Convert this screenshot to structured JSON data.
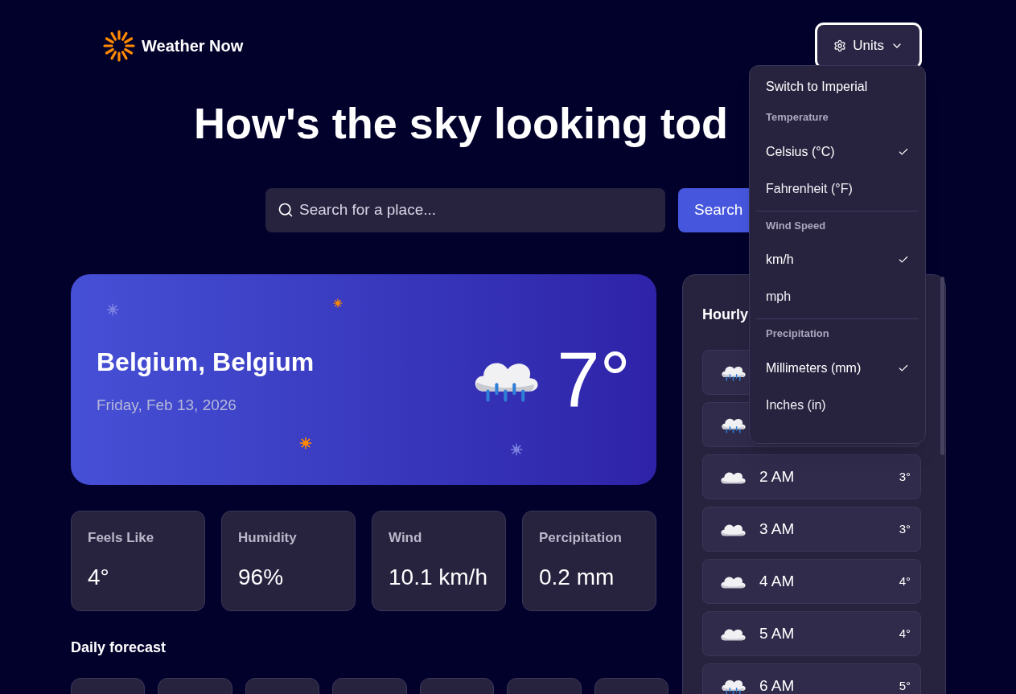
{
  "header": {
    "logo_text": "Weather Now",
    "units_button": {
      "label": "Units",
      "expanded": true
    }
  },
  "units_menu": {
    "action": "Switch to Imperial",
    "groups": [
      {
        "heading": "Temperature",
        "options": [
          {
            "label": "Celsius (°C)",
            "selected": true
          },
          {
            "label": "Fahrenheit (°F)",
            "selected": false
          }
        ]
      },
      {
        "heading": "Wind Speed",
        "options": [
          {
            "label": "km/h",
            "selected": true
          },
          {
            "label": "mph",
            "selected": false
          }
        ]
      },
      {
        "heading": "Precipitation",
        "options": [
          {
            "label": "Millimeters (mm)",
            "selected": true
          },
          {
            "label": "Inches (in)",
            "selected": false
          }
        ]
      }
    ]
  },
  "hero_title": "How's the sky looking tod",
  "search": {
    "placeholder": "Search for a place...",
    "button": "Search"
  },
  "current": {
    "location": "Belgium, Belgium",
    "date": "Friday, Feb 13, 2026",
    "temperature": "7°",
    "kind": "rain"
  },
  "stats": [
    {
      "label": "Feels Like",
      "value": "4°"
    },
    {
      "label": "Humidity",
      "value": "96%"
    },
    {
      "label": "Wind",
      "value": "10.1 km/h"
    },
    {
      "label": "Percipitation",
      "value": "0.2 mm"
    }
  ],
  "daily_forecast": {
    "title": "Daily forecast"
  },
  "hourly": {
    "title": "Hourly",
    "rows": [
      {
        "kind": "rain"
      },
      {
        "kind": "rain"
      },
      {
        "kind": "cloud",
        "time": "2 AM",
        "temp": "3°"
      },
      {
        "kind": "cloud",
        "time": "3 AM",
        "temp": "3°"
      },
      {
        "kind": "cloud",
        "time": "4 AM",
        "temp": "4°"
      },
      {
        "kind": "cloud",
        "time": "5 AM",
        "temp": "4°"
      },
      {
        "kind": "rain",
        "time": "6 AM",
        "temp": "5°"
      }
    ]
  }
}
